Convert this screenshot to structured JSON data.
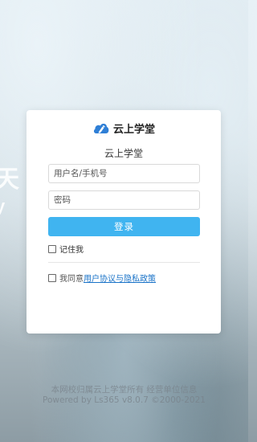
{
  "background": {
    "text_line1": "天",
    "text_line2": "y"
  },
  "header": {
    "logo_text": "云上学堂",
    "subtitle": "云上学堂",
    "logo_icon": "cloud-pen-icon"
  },
  "form": {
    "username_placeholder": "用户名/手机号",
    "password_placeholder": "密码",
    "login_label": "登录",
    "remember_label": "记住我",
    "agree_prefix": "我同意",
    "agree_link": "用户协议与隐私政策"
  },
  "footer": {
    "line1": "本网校归属云上学堂所有 经营单位信息",
    "line2": "Powered by Ls365 v8.0.7 ©2000-2021"
  },
  "colors": {
    "accent": "#40b4f0",
    "link": "#1a73c8",
    "logo_blue": "#2f7fd6"
  }
}
